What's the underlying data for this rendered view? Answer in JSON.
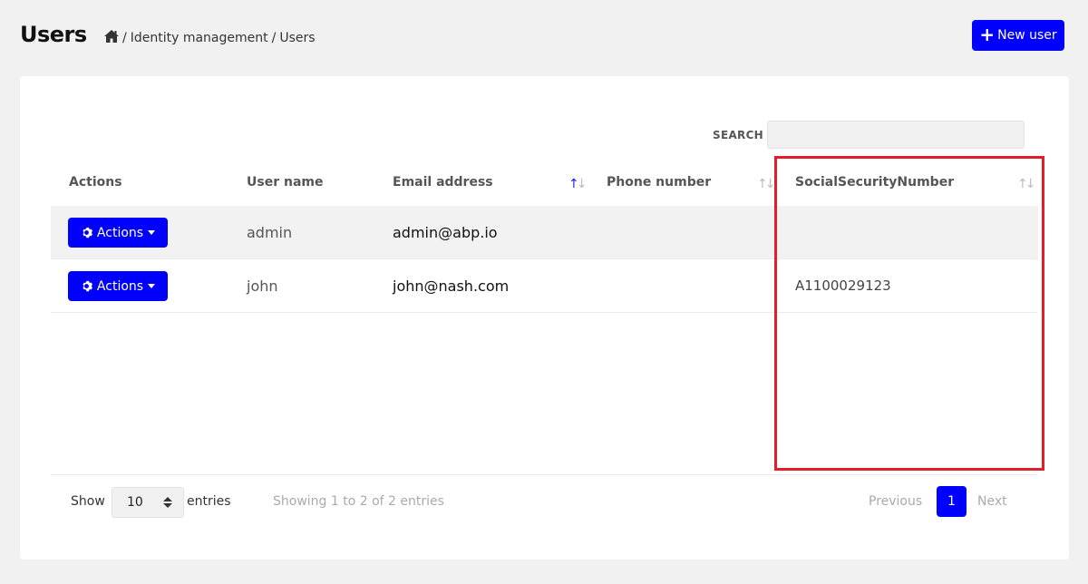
{
  "header": {
    "title": "Users",
    "breadcrumb": {
      "home_icon": "home-icon",
      "items": [
        "Identity management",
        "Users"
      ],
      "separator": "/"
    },
    "new_user_button": {
      "icon": "plus-icon",
      "label": "New user"
    }
  },
  "table": {
    "search_label": "SEARCH",
    "search_value": "",
    "columns": [
      "Actions",
      "User name",
      "Email address",
      "Phone number",
      "SocialSecurityNumber"
    ],
    "rows": [
      {
        "actions_label": "Actions",
        "username": "admin",
        "email": "admin@abp.io",
        "phone": "",
        "ssn": ""
      },
      {
        "actions_label": "Actions",
        "username": "john",
        "email": "john@nash.com",
        "phone": "",
        "ssn": "A1100029123"
      }
    ]
  },
  "footer": {
    "show_label": "Show",
    "page_size": "10",
    "entries_label": "entries",
    "info": "Showing 1 to 2 of 2 entries",
    "previous": "Previous",
    "current_page": "1",
    "next": "Next"
  },
  "colors": {
    "accent": "#0000ff",
    "highlight": "#e01f2a",
    "background": "#f1f1f2"
  }
}
